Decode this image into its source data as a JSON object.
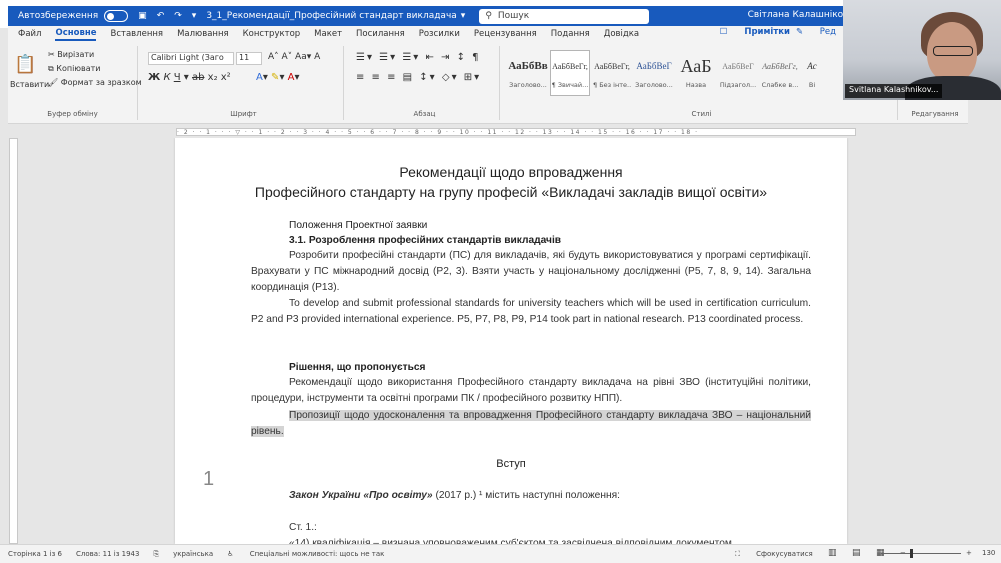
{
  "titlebar": {
    "autosave": "Автозбереження",
    "doc_title": "3_1_Рекомендації_Професійний стандарт викладача",
    "search": "Пошук",
    "user": "Світлана Калашнікова"
  },
  "menu": {
    "tabs": [
      "Файл",
      "Основне",
      "Вставлення",
      "Малювання",
      "Конструктор",
      "Макет",
      "Посилання",
      "Розсилки",
      "Рецензування",
      "Подання",
      "Довідка"
    ],
    "active": "Основне",
    "comments": "Примітки",
    "edit": "Ред"
  },
  "ribbon": {
    "clipboard": {
      "paste": "Вставити",
      "cut": "Вирізати",
      "copy": "Копіювати",
      "format_painter": "Формат за зразком",
      "label": "Буфер обміну"
    },
    "font": {
      "name": "Calibri Light (Заго",
      "size": "11",
      "label": "Шрифт"
    },
    "paragraph": {
      "label": "Абзац"
    },
    "styles": {
      "label": "Стилі",
      "items": [
        {
          "sample": "АаБбВв",
          "name": "Заголово..."
        },
        {
          "sample": "АаБбВеГг,",
          "name": "¶ Звичай..."
        },
        {
          "sample": "АаБбВеГг,",
          "name": "¶ Без інте..."
        },
        {
          "sample": "АаБбВеГ",
          "name": "Заголово..."
        },
        {
          "sample": "АаБ",
          "name": "Назва"
        },
        {
          "sample": "АаБбВеГ",
          "name": "Підзагол..."
        },
        {
          "sample": "АаБбВеГг,",
          "name": "Слабке в..."
        },
        {
          "sample": "Ac",
          "name": "Ві"
        }
      ]
    },
    "editing": {
      "label": "Редагування"
    }
  },
  "document": {
    "title_line1": "Рекомендації щодо впровадження",
    "title_line2": "Професійного стандарту на групу професій «Викладачі закладів вищої освіти»",
    "section_heading": "Положення Проектної заявки",
    "subsection_heading": "3.1. Розроблення професійних стандартів викладачів",
    "para_ua": "Розробити професійні стандарти (ПС) для викладачів, які будуть використовуватися у програмі сертифікації. Врахувати у ПС міжнародний досвід (Р2, 3). Взяти участь у національному дослідженні (Р5, 7, 8, 9, 14). Загальна координація (Р13).",
    "para_en": "To develop and submit professional standards for university teachers which will be used in certification curriculum. P2 and P3 provided international experience. P5, P7, P8, P9, P14 took part in national research. P13 coordinated process.",
    "solution_heading": "Рішення, що пропонується",
    "solution_para1": "Рекомендації щодо використання Професійного стандарту викладача на рівні ЗВО (інституційні політики, процедури, інструменти та освітні програми ПК / професійного розвитку НПП).",
    "solution_para2": "Пропозиції щодо удосконалення та впровадження Професійного стандарту викладача ЗВО – національний рівень.",
    "page_number": "1",
    "intro_heading": "Вступ",
    "law_bold": "Закон України «Про освіту»",
    "law_rest": " (2017 р.) ¹ містить наступні положення:",
    "article": "Ст. 1.:",
    "article_cut": "«14) кваліфікація – визнана уповноваженим суб'єктом та засвідчена відповідним документом"
  },
  "statusbar": {
    "page": "Сторінка 1 із 6",
    "words": "Слова: 11 із 1943",
    "language": "українська",
    "accessibility": "Спеціальні можливості: щось не так",
    "focus": "Сфокусуватися",
    "zoom": "130"
  },
  "video": {
    "participant": "Svitlana Kalashnikov..."
  }
}
